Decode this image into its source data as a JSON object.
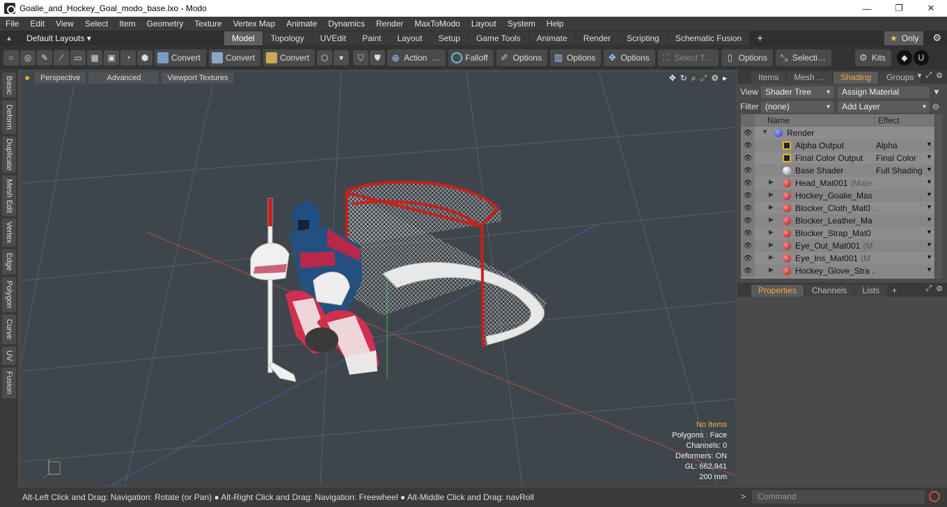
{
  "window": {
    "title": "Goalie_and_Hockey_Goal_modo_base.lxo - Modo",
    "minimize": "—",
    "maximize": "❐",
    "close": "✕"
  },
  "menu": [
    "File",
    "Edit",
    "View",
    "Select",
    "Item",
    "Geometry",
    "Texture",
    "Vertex Map",
    "Animate",
    "Dynamics",
    "Render",
    "MaxToModo",
    "Layout",
    "System",
    "Help"
  ],
  "layoutbar": {
    "default_layouts": "Default Layouts ▾",
    "tabs": [
      "Model",
      "Topology",
      "UVEdit",
      "Paint",
      "Layout",
      "Setup",
      "Game Tools",
      "Animate",
      "Render",
      "Scripting",
      "Schematic Fusion"
    ],
    "active_tab": "Model",
    "only_label": "Only"
  },
  "toolbar": {
    "convert1": "Convert",
    "convert2": "Convert",
    "convert3": "Convert",
    "action": "Action",
    "ellipsis": "…",
    "falloff": "Falloff",
    "options1": "Options",
    "options2": "Options",
    "options3": "Options",
    "select_t": "Select T…",
    "options4": "Options",
    "selecti": "Selecti…",
    "kits": "Kits"
  },
  "left_tabs": [
    "Basic",
    "Deform",
    "Duplicate",
    "Mesh Edit",
    "Vertex",
    "Edge",
    "Polygon",
    "Curve",
    "UV",
    "Fusion"
  ],
  "viewport": {
    "tabs": [
      "Perspective",
      "Advanced",
      "Viewport Textures"
    ],
    "info": {
      "no_items": "No Items",
      "polygons": "Polygons : Face",
      "channels": "Channels: 0",
      "deformers": "Deformers: ON",
      "gl": "GL: 662,941",
      "scale": "200 mm"
    }
  },
  "status": {
    "hint": "Alt-Left Click and Drag: Navigation: Rotate (or Pan) ● Alt-Right Click and Drag: Navigation: Freewheel ● Alt-Middle Click and Drag: navRoll",
    "command_placeholder": "Command",
    "arrow": ">"
  },
  "right_panel": {
    "top_tabs": [
      "Items",
      "Mesh …",
      "Shading",
      "Groups"
    ],
    "active_top_tab": "Shading",
    "view_label": "View",
    "view_value": "Shader Tree",
    "assign_material": "Assign Material",
    "filter_label": "Filter",
    "filter_value": "(none)",
    "add_layer": "Add Layer",
    "columns": {
      "name": "Name",
      "effect": "Effect"
    },
    "rows": [
      {
        "name": "Render",
        "dim": "",
        "effect": "",
        "icon": "sphere-blue",
        "indent": 0,
        "expander": "▼"
      },
      {
        "name": "Alpha Output",
        "dim": "",
        "effect": "Alpha",
        "icon": "output",
        "indent": 1,
        "expander": ""
      },
      {
        "name": "Final Color Output",
        "dim": "",
        "effect": "Final Color",
        "icon": "output",
        "indent": 1,
        "expander": ""
      },
      {
        "name": "Base Shader",
        "dim": "",
        "effect": "Full Shading",
        "icon": "sphere-white",
        "indent": 1,
        "expander": ""
      },
      {
        "name": "Head_Mat001",
        "dim": "(Mate…",
        "effect": "",
        "icon": "material",
        "indent": 1,
        "expander": "▶"
      },
      {
        "name": "Hockey_Goalie_Mas …",
        "dim": "",
        "effect": "",
        "icon": "material",
        "indent": 1,
        "expander": "▶"
      },
      {
        "name": "Blocker_Cloth_Mat0 …",
        "dim": "",
        "effect": "",
        "icon": "material",
        "indent": 1,
        "expander": "▶"
      },
      {
        "name": "Blocker_Leather_Ma …",
        "dim": "",
        "effect": "",
        "icon": "material",
        "indent": 1,
        "expander": "▶"
      },
      {
        "name": "Blocker_Strap_Mat0 …",
        "dim": "",
        "effect": "",
        "icon": "material",
        "indent": 1,
        "expander": "▶"
      },
      {
        "name": "Eye_Out_Mat001",
        "dim": "(M…",
        "effect": "",
        "icon": "material",
        "indent": 1,
        "expander": "▶"
      },
      {
        "name": "Eye_Ins_Mat001",
        "dim": "(M …",
        "effect": "",
        "icon": "material",
        "indent": 1,
        "expander": "▶"
      },
      {
        "name": "Hockey_Glove_Stra …",
        "dim": "",
        "effect": "",
        "icon": "material",
        "indent": 1,
        "expander": "▶"
      }
    ],
    "bottom_tabs": [
      "Properties",
      "Channels",
      "Lists"
    ],
    "active_bottom_tab": "Properties",
    "plus": "+"
  },
  "colors": {
    "accent": "#f0a640",
    "goal_red": "#c8201c",
    "jersey_blue": "#23507f",
    "jersey_red": "#b8284a"
  }
}
